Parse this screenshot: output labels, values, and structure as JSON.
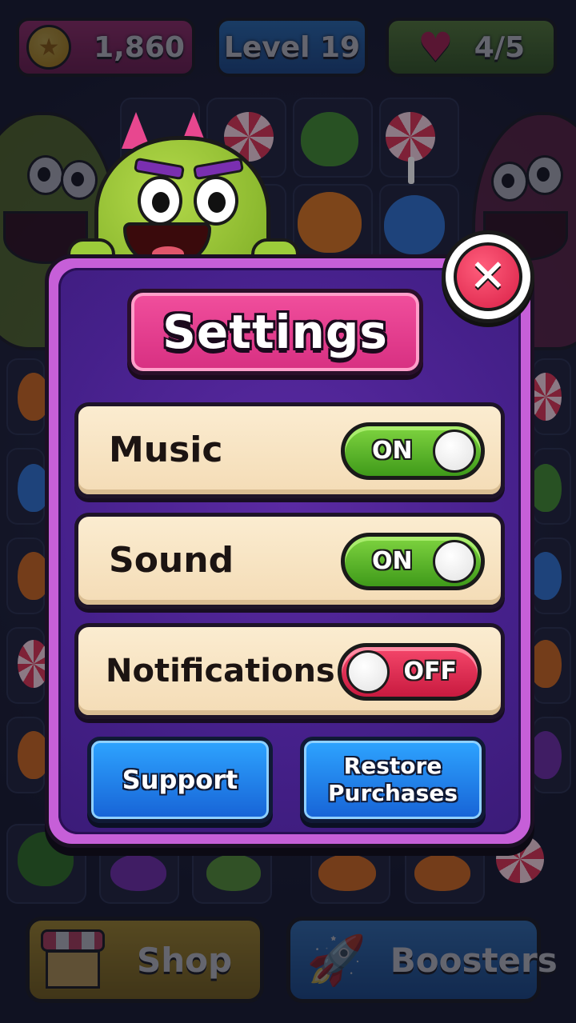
{
  "hud": {
    "coins": "1,860",
    "level": "Level 19",
    "lives": "4/5",
    "coin_icon": "star-coin-icon",
    "heart_icon": "heart-icon"
  },
  "dialog": {
    "title": "Settings",
    "close_symbol": "✕",
    "rows": [
      {
        "label": "Music",
        "state": "ON"
      },
      {
        "label": "Sound",
        "state": "ON"
      },
      {
        "label": "Notifications",
        "state": "OFF"
      }
    ],
    "support_label": "Support",
    "restore_line1": "Restore",
    "restore_line2": "Purchases"
  },
  "bottom": {
    "shop_label": "Shop",
    "boosters_label": "Boosters"
  },
  "colors": {
    "dialog_frame": "#c65fd8",
    "dialog_fill": "#45208a",
    "title_plaque": "#e13d8c",
    "toggle_on": "#5cb82c",
    "toggle_off": "#e02e55",
    "action_button": "#2382ea",
    "close_button": "#e5304f"
  }
}
